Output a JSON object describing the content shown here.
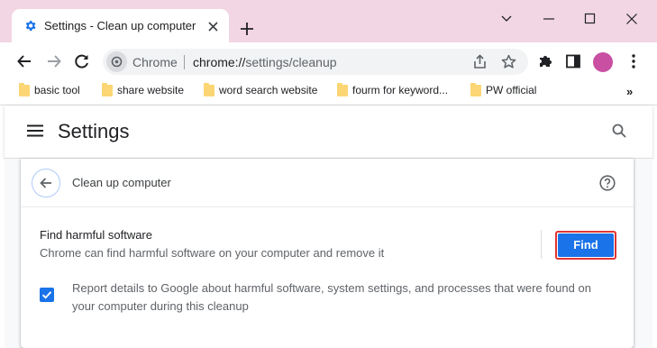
{
  "tab": {
    "title": "Settings - Clean up computer"
  },
  "omnibox": {
    "chip": "Chrome",
    "url_host": "chrome://",
    "url_path": "settings/cleanup"
  },
  "profile": {
    "initial": ""
  },
  "bookmarks": [
    {
      "label": "basic tool"
    },
    {
      "label": "share website"
    },
    {
      "label": "word search website"
    },
    {
      "label": "fourm for keyword..."
    },
    {
      "label": "PW official"
    }
  ],
  "bookmarks_more": "»",
  "settings": {
    "title": "Settings"
  },
  "cleanup": {
    "subpage_title": "Clean up computer",
    "find_title": "Find harmful software",
    "find_description": "Chrome can find harmful software on your computer and remove it",
    "find_button": "Find",
    "report_text": "Report details to Google about harmful software, system settings, and processes that were found on your computer during this cleanup",
    "report_checked": true
  },
  "colors": {
    "titlebar": "#f2d6e4",
    "accent": "#1a73e8",
    "highlight_border": "#e03434",
    "folder": "#fcd674"
  },
  "icons": {
    "tab": "gear-icon",
    "back": "back-arrow-icon",
    "forward": "forward-arrow-icon",
    "reload": "reload-icon",
    "share": "share-icon",
    "bookmark_star": "star-icon",
    "extensions": "puzzle-icon",
    "side_panel": "side-panel-icon",
    "menu": "kebab-menu-icon",
    "hamburger": "hamburger-icon",
    "search": "search-icon",
    "help": "help-icon"
  }
}
